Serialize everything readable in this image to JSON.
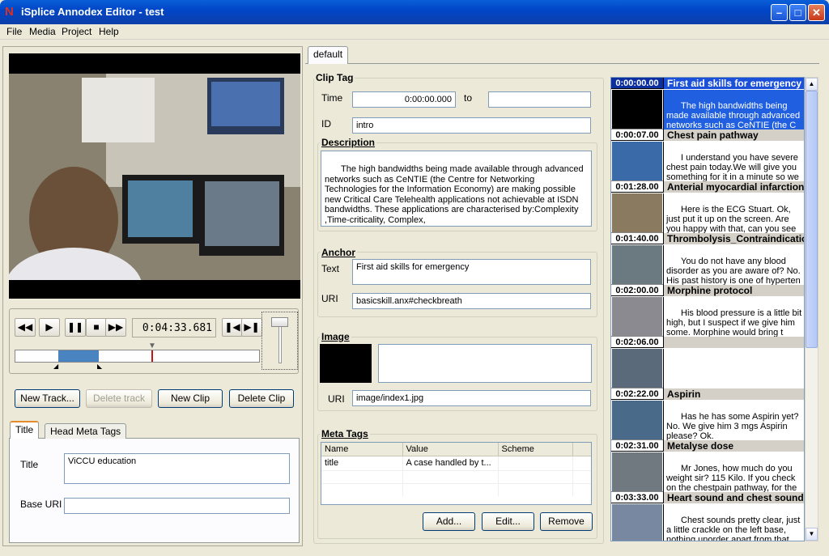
{
  "window": {
    "title": "iSplice Annodex Editor - test",
    "icon": "N"
  },
  "menu": [
    "File",
    "Media",
    "Project",
    "Help"
  ],
  "player": {
    "time": "0:04:33.681"
  },
  "track_buttons": {
    "new_track": "New Track...",
    "delete_track": "Delete track",
    "new_clip": "New Clip",
    "delete_clip": "Delete Clip"
  },
  "tabs": {
    "title": "Title",
    "head_meta": "Head Meta Tags",
    "default": "default"
  },
  "title_tab": {
    "title_label": "Title",
    "title_value": "ViCCU education",
    "base_uri_label": "Base URI",
    "base_uri_value": ""
  },
  "clip_tag": {
    "label": "Clip Tag",
    "time_label": "Time",
    "time_value": "0:00:00.000",
    "to_label": "to",
    "to_value": "",
    "id_label": "ID",
    "id_value": "intro"
  },
  "description": {
    "label": "Description",
    "text": "The high bandwidths being made available through advanced networks such as CeNTIE (the Centre for Networking Technologies for the Information Economy) are making possible new Critical Care Telehealth applications not achievable at ISDN bandwidths. These applications are characterised by:Complexity ,Time-criticality, Complex,"
  },
  "anchor": {
    "label": "Anchor",
    "text_label": "Text",
    "text_value": "First aid skills for emergency",
    "uri_label": "URI",
    "uri_value": "basicskill.anx#checkbreath"
  },
  "image": {
    "label": "Image",
    "uri_label": "URI",
    "uri_value": "image/index1.jpg"
  },
  "meta_tags": {
    "label": "Meta Tags",
    "columns": [
      "Name",
      "Value",
      "Scheme"
    ],
    "rows": [
      {
        "name": "title",
        "value": "A case handled by t...",
        "scheme": ""
      }
    ],
    "add": "Add...",
    "edit": "Edit...",
    "remove": "Remove"
  },
  "clips": [
    {
      "time": "0:00:00.00",
      "title": "First aid skills for emergency",
      "desc": "The high bandwidths being made available through advanced networks such as CeNTIE (the C",
      "selected": true
    },
    {
      "time": "0:00:07.00",
      "title": "Chest pain pathway",
      "desc": "I understand you have severe chest pain today.We will give you something for it in a minute so we",
      "selected": false
    },
    {
      "time": "0:01:28.00",
      "title": "Anterial myocardial infarction",
      "desc": "Here is the ECG Stuart. Ok, just put it up on the screen. Are you happy with that, can you see",
      "selected": false
    },
    {
      "time": "0:01:40.00",
      "title": "Thrombolysis_Contraindicatio",
      "desc": "You do not have any blood disorder as you are aware of? No. His past history is one of hyperten",
      "selected": false
    },
    {
      "time": "0:02:00.00",
      "title": "Morphine protocol",
      "desc": "His blood pressure is a little bit high, but I suspect if we give him some. Morphine would bring t",
      "selected": false
    },
    {
      "time": "0:02:06.00",
      "title": "",
      "desc": "",
      "selected": false
    },
    {
      "time": "0:02:22.00",
      "title": "Aspirin",
      "desc": "Has he has some Aspirin yet? No. We give him 3 mgs Aspirin please? Ok.",
      "selected": false
    },
    {
      "time": "0:02:31.00",
      "title": "Metalyse dose",
      "desc": "Mr Jones, how much do you weight sir? 115 Kilo. If you check on the chestpain pathway, for the",
      "selected": false
    },
    {
      "time": "0:03:33.00",
      "title": "Heart sound and chest sound",
      "desc": "Chest sounds pretty clear, just a little crackle on the left base, nothing unorder apart from that",
      "selected": false
    }
  ]
}
